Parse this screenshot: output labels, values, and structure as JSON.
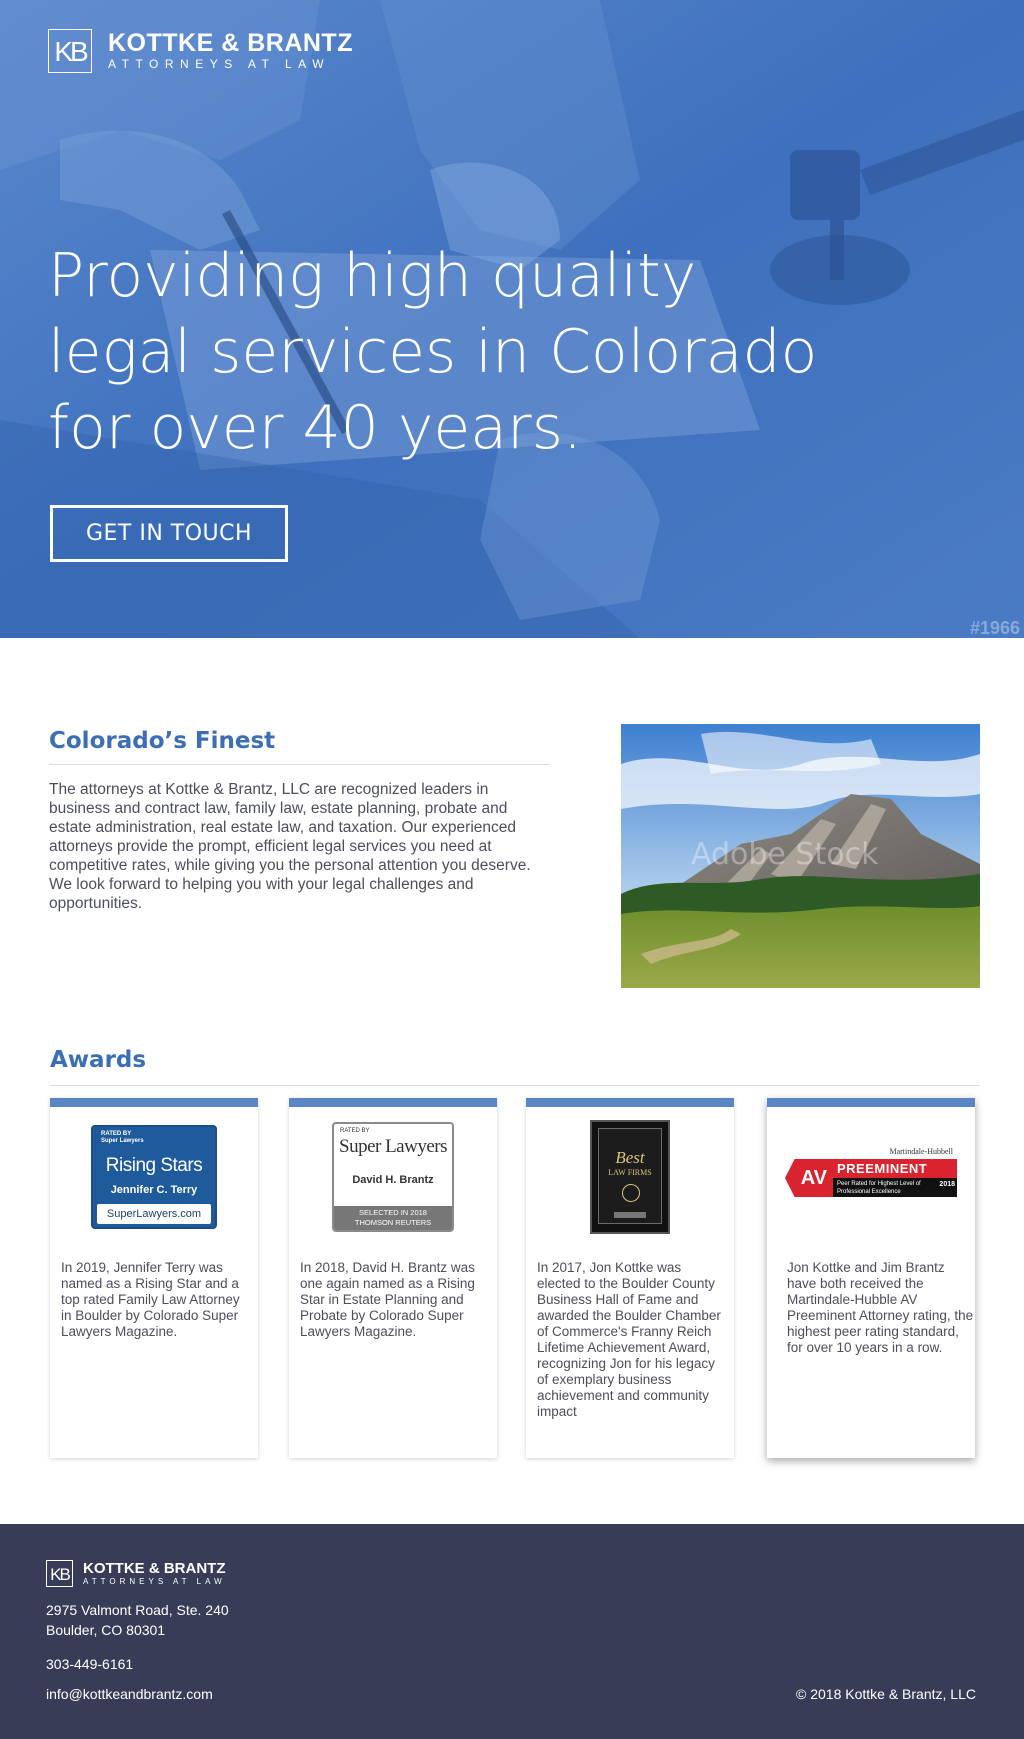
{
  "header": {
    "logo_mark": "KB",
    "logo_name": "KOTTKE & BRANTZ",
    "logo_tagline": "ATTORNEYS AT LAW"
  },
  "hero": {
    "headline_lines": [
      "Providing high quality",
      "legal services in Colorado",
      "for over 40 years."
    ],
    "cta_label": "GET IN TOUCH",
    "stamp": "#1966"
  },
  "about": {
    "title": "Colorado’s Finest",
    "body": "The attorneys at Kottke & Brantz, LLC  are recognized leaders in business and contract law, family law, estate planning, probate and estate administration, real estate law, and taxation. Our experienced attorneys provide the prompt, efficient legal services you need at competitive rates, while giving you the personal attention you deserve.  We look forward to helping you with your legal challenges and opportunities.",
    "photo_watermark": "Adobe Stock"
  },
  "awards": {
    "title": "Awards",
    "items": [
      {
        "badge_small": "RATED BY",
        "badge_small2": "Super Lawyers",
        "badge_title": "Rising Stars",
        "badge_name": "Jennifer C. Terry",
        "badge_footer": "SuperLawyers.com",
        "text": "In 2019, Jennifer Terry was named as a Rising Star and a top rated Family Law Attorney in Boulder by Colorado Super Lawyers Magazine."
      },
      {
        "badge_small": "RATED BY",
        "badge_title": "Super Lawyers",
        "badge_name": "David H. Brantz",
        "badge_footer": "SELECTED IN 2018",
        "badge_footer2": "THOMSON REUTERS",
        "text": "In 2018, David H. Brantz was one again named as a Rising Star in Estate Planning and Probate by Colorado Super Lawyers Magazine."
      },
      {
        "badge_title": "Best",
        "badge_sub": "LAW FIRMS",
        "text": "In 2017, Jon Kottke was elected to the Boulder County Business Hall of Fame and awarded the Boulder Chamber of Commerce's Franny Reich Lifetime Achievement Award, recognizing Jon for his legacy of exemplary business achievement and community impact"
      },
      {
        "badge_top": "Martindale-Hubbell",
        "badge_av": "AV",
        "badge_title": "PREEMINENT",
        "badge_sub": "Peer Rated for Highest Level of Professional Excellence",
        "badge_year": "2018",
        "text": "Jon Kottke and Jim Brantz have both received the Martindale-Hubble AV Preeminent Attorney rating, the highest peer rating standard, for over 10 years in a row."
      }
    ]
  },
  "footer": {
    "logo_mark": "KB",
    "logo_name": "KOTTKE & BRANTZ",
    "logo_tagline": "ATTORNEYS AT LAW",
    "address_line1": "2975 Valmont Road, Ste. 240",
    "address_line2": "Boulder, CO 80301",
    "phone": "303-449-6161",
    "email": "info@kottkeandbrantz.com",
    "copyright": "© 2018 Kottke & Brantz, LLC"
  },
  "colors": {
    "hero_blue": "#4477c2",
    "accent_blue": "#3a6fb6",
    "card_bar": "#5a86c5",
    "footer_bg": "#393c57"
  }
}
